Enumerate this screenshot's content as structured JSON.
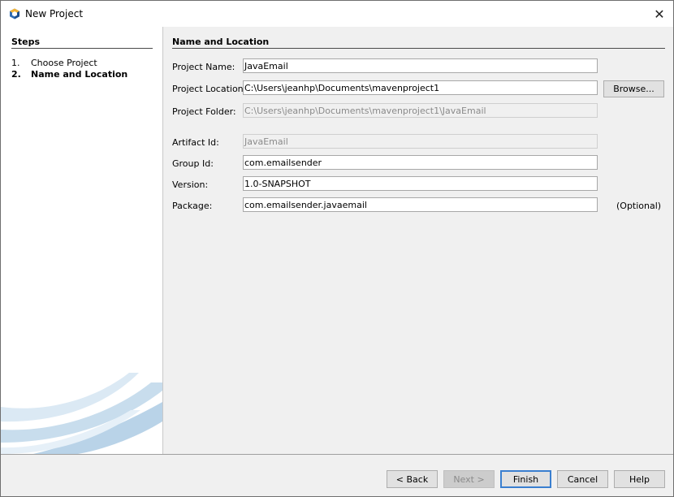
{
  "window": {
    "title": "New Project",
    "app_icon": "netbeans-icon",
    "close_icon": "close-icon",
    "close_glyph": "✕"
  },
  "steps": {
    "title": "Steps",
    "items": [
      {
        "number": "1.",
        "label": "Choose Project",
        "active": false
      },
      {
        "number": "2.",
        "label": "Name and Location",
        "active": true
      }
    ]
  },
  "main": {
    "section_title": "Name and Location",
    "project_name": {
      "label": "Project Name:",
      "value": "JavaEmail"
    },
    "project_location": {
      "label": "Project Location:",
      "value": "C:\\Users\\jeanhp\\Documents\\mavenproject1",
      "browse_label": "Browse..."
    },
    "project_folder": {
      "label": "Project Folder:",
      "value": "C:\\Users\\jeanhp\\Documents\\mavenproject1\\JavaEmail"
    },
    "artifact_id": {
      "label": "Artifact Id:",
      "value": "JavaEmail"
    },
    "group_id": {
      "label": "Group Id:",
      "value": "com.emailsender"
    },
    "version": {
      "label": "Version:",
      "value": "1.0-SNAPSHOT"
    },
    "package": {
      "label": "Package:",
      "value": "com.emailsender.javaemail",
      "optional_label": "(Optional)"
    }
  },
  "buttons": {
    "back": "< Back",
    "next": "Next >",
    "finish": "Finish",
    "cancel": "Cancel",
    "help": "Help"
  },
  "colors": {
    "accent": "#6b5aa8",
    "panel_bg": "#f0f0f0",
    "default_button_border": "#3a7fd0"
  }
}
